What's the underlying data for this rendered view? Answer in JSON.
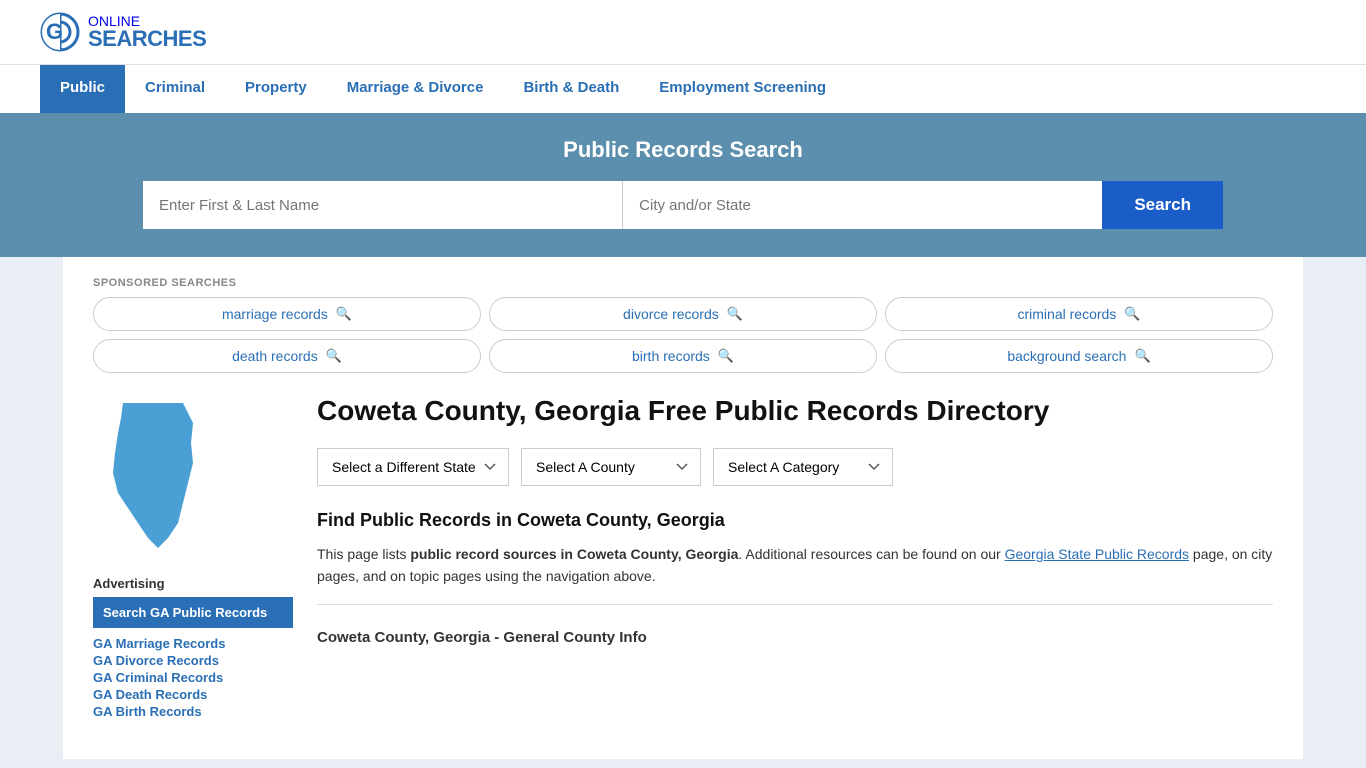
{
  "logo": {
    "online": "ONLINE",
    "searches": "SEARCHES"
  },
  "nav": {
    "items": [
      {
        "label": "Public",
        "active": true
      },
      {
        "label": "Criminal",
        "active": false
      },
      {
        "label": "Property",
        "active": false
      },
      {
        "label": "Marriage & Divorce",
        "active": false
      },
      {
        "label": "Birth & Death",
        "active": false
      },
      {
        "label": "Employment Screening",
        "active": false
      }
    ]
  },
  "search_banner": {
    "title": "Public Records Search",
    "name_placeholder": "Enter First & Last Name",
    "location_placeholder": "City and/or State",
    "button_label": "Search"
  },
  "sponsored": {
    "label": "SPONSORED SEARCHES",
    "items": [
      "marriage records",
      "divorce records",
      "criminal records",
      "death records",
      "birth records",
      "background search"
    ]
  },
  "content": {
    "title": "Coweta County, Georgia Free Public Records Directory",
    "dropdowns": {
      "state_label": "Select a Different State",
      "county_label": "Select A County",
      "category_label": "Select A Category"
    },
    "find_title": "Find Public Records in Coweta County, Georgia",
    "find_text_1": "This page lists ",
    "find_bold": "public record sources in Coweta County, Georgia",
    "find_text_2": ". Additional resources can be found on our ",
    "find_link": "Georgia State Public Records",
    "find_text_3": " page, on city pages, and on topic pages using the navigation above.",
    "section_title": "Coweta County, Georgia - General County Info"
  },
  "sidebar": {
    "ad_label": "Advertising",
    "ad_highlight": "Search GA Public Records",
    "links": [
      "GA Marriage Records",
      "GA Divorce Records",
      "GA Criminal Records",
      "GA Death Records",
      "GA Birth Records"
    ]
  }
}
